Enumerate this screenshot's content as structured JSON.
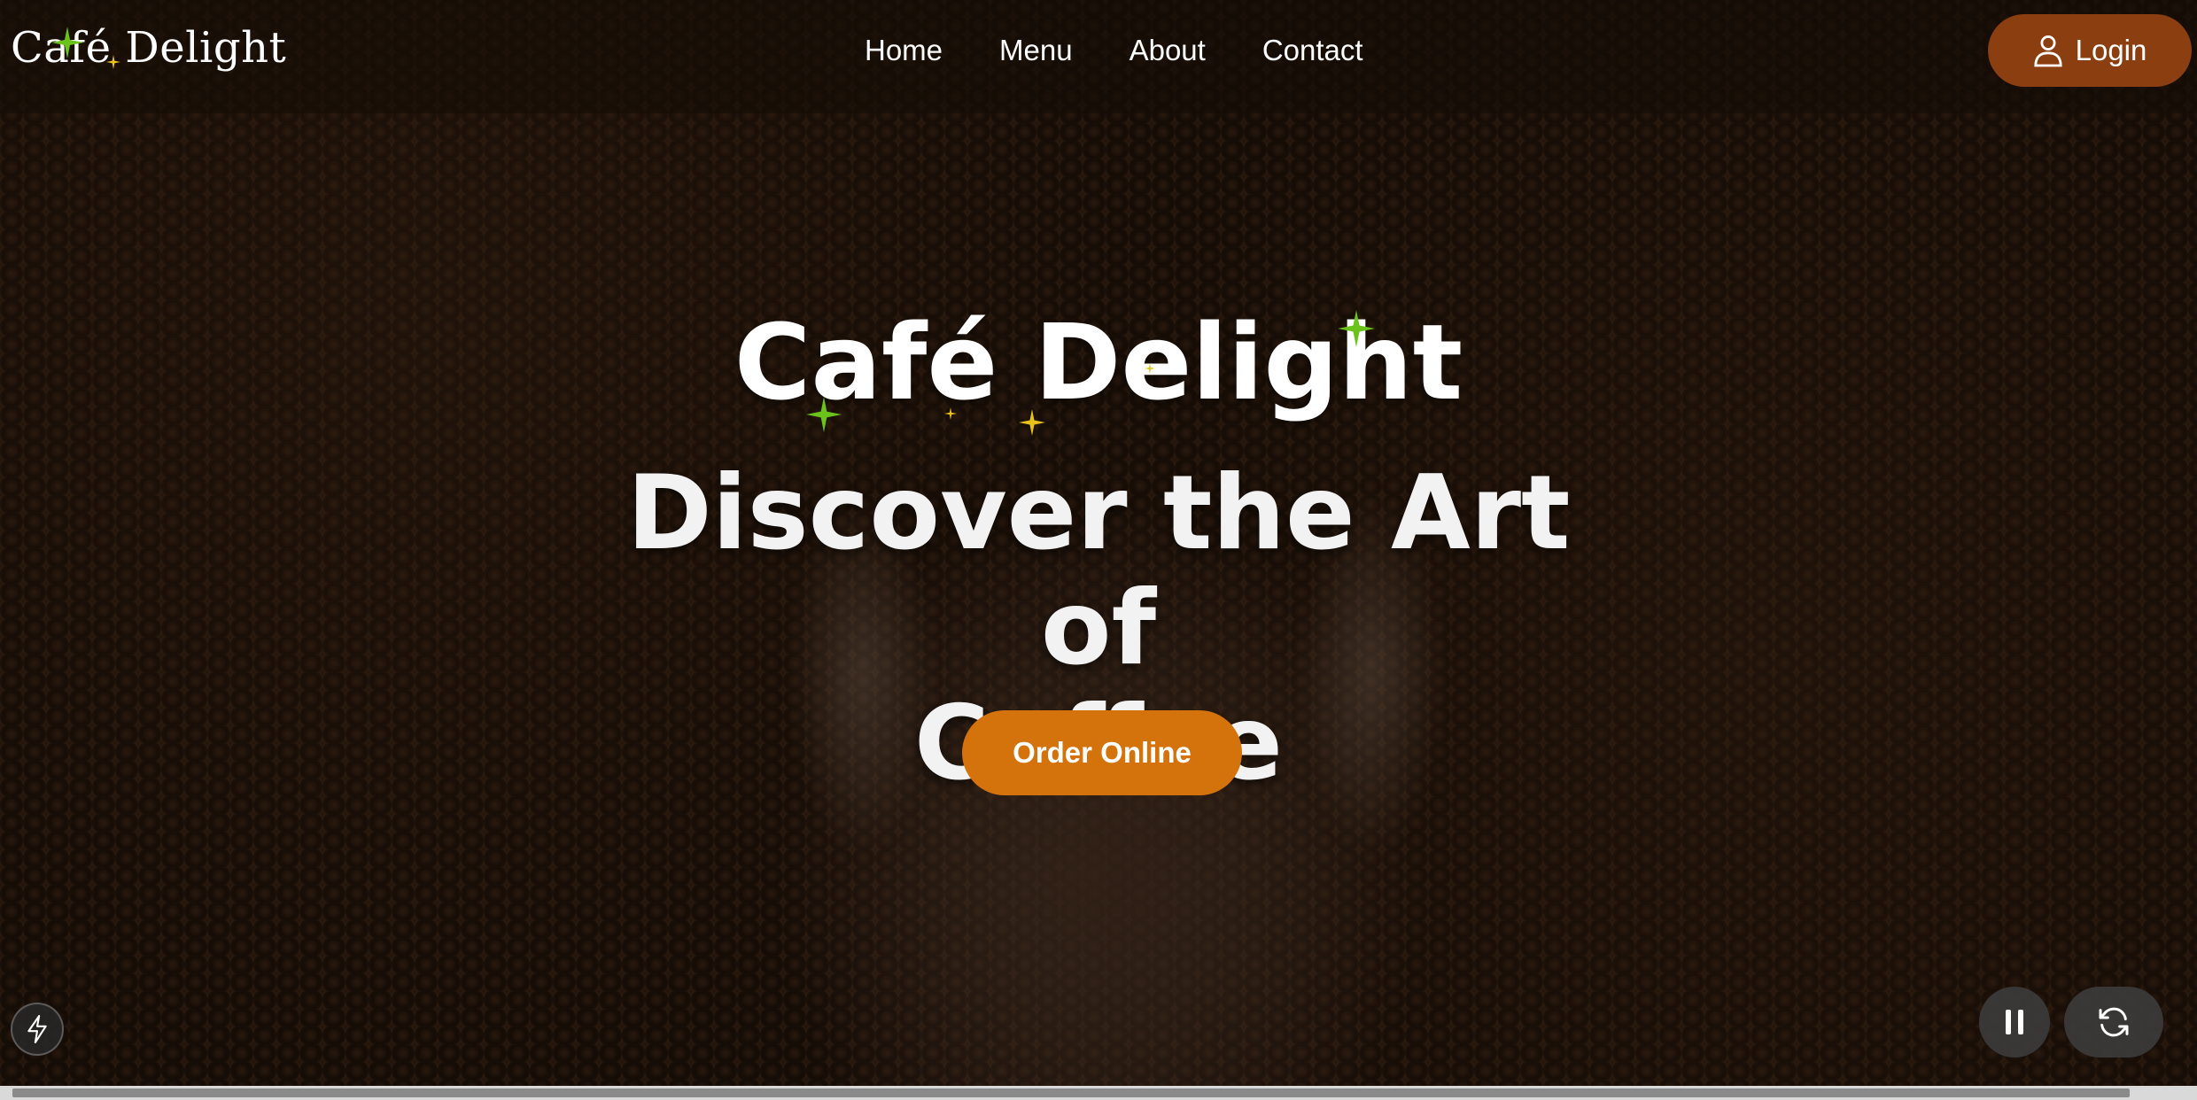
{
  "header": {
    "logo": "Café Delight",
    "nav": [
      {
        "label": "Home"
      },
      {
        "label": "Menu"
      },
      {
        "label": "About"
      },
      {
        "label": "Contact"
      }
    ],
    "login_label": "Login",
    "login_icon": "user-icon",
    "colors": {
      "login_bg": "#8b3e10"
    }
  },
  "hero": {
    "title": "Café Delight",
    "subtitle_line1": "Discover the Art of",
    "subtitle_line2": "Coffee",
    "cta_label": "Order Online",
    "colors": {
      "cta_bg": "#d4720c",
      "sparkle_green": "#6ac21a",
      "sparkle_yellow": "#e8c21a"
    }
  },
  "controls": {
    "bolt_icon": "lightning-bolt-icon",
    "pause_icon": "pause-icon",
    "refresh_icon": "refresh-icon"
  }
}
